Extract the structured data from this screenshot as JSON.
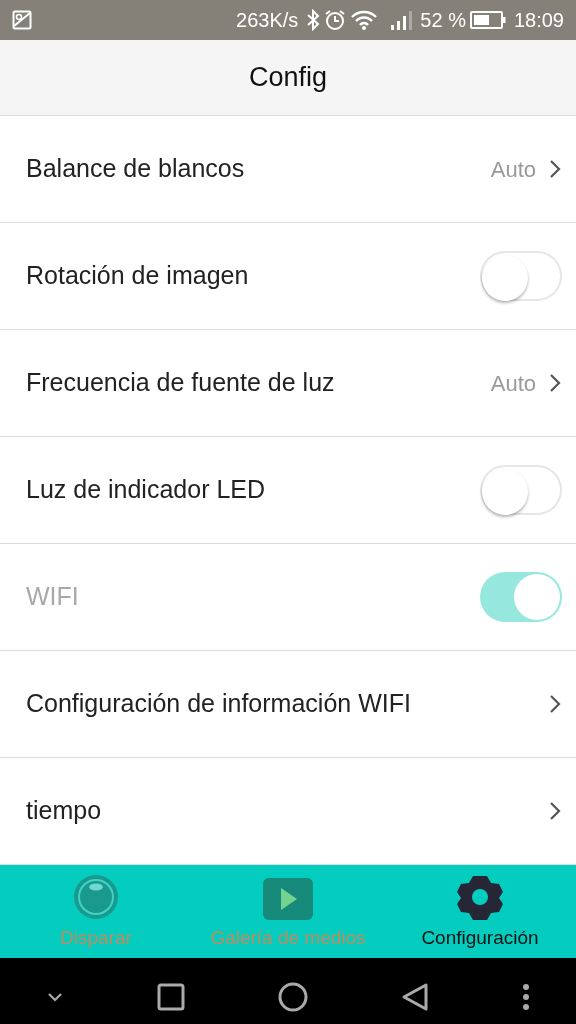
{
  "status_bar": {
    "speed": "263K/s",
    "battery": "52 %",
    "time": "18:09"
  },
  "header": {
    "title": "Config"
  },
  "settings": [
    {
      "kind": "value",
      "label": "Balance de blancos",
      "value": "Auto",
      "disabled": false
    },
    {
      "kind": "toggle",
      "label": "Rotación de imagen",
      "on": false,
      "disabled": false
    },
    {
      "kind": "value",
      "label": "Frecuencia de fuente de luz",
      "value": "Auto",
      "disabled": false
    },
    {
      "kind": "toggle",
      "label": "Luz de indicador LED",
      "on": false,
      "disabled": false
    },
    {
      "kind": "toggle",
      "label": "WIFI",
      "on": true,
      "disabled": true
    },
    {
      "kind": "link",
      "label": "Configuración de información WIFI",
      "disabled": false
    },
    {
      "kind": "link",
      "label": "tiempo",
      "disabled": false
    }
  ],
  "bottom_nav": [
    {
      "kind": "shoot",
      "label": "Disparar",
      "selected": false
    },
    {
      "kind": "gallery",
      "label": "Galería de medios",
      "selected": false
    },
    {
      "kind": "settings",
      "label": "Configuración",
      "selected": true
    }
  ]
}
